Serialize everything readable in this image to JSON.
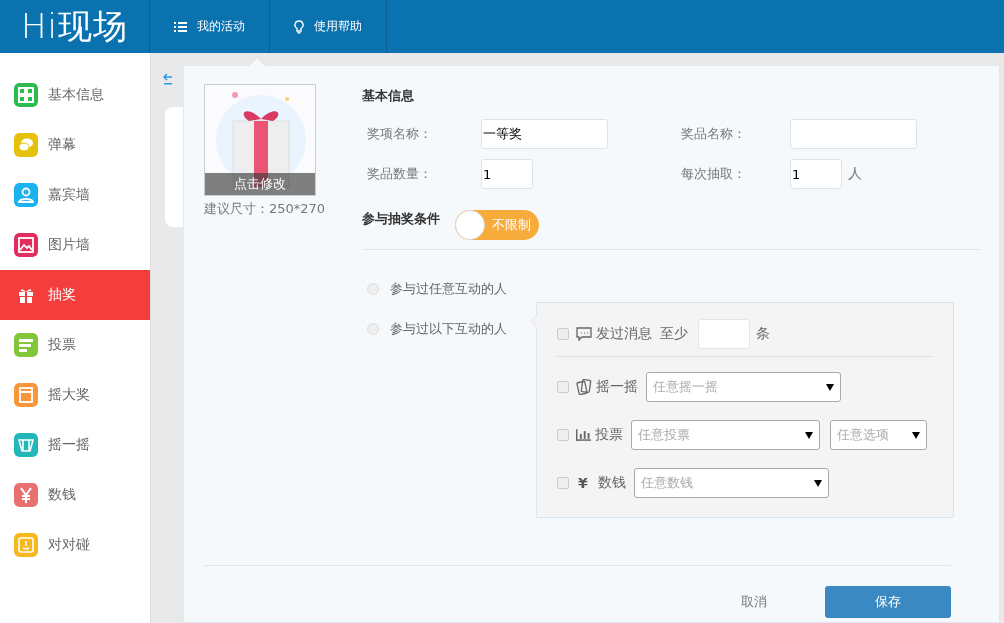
{
  "header": {
    "logo": "Hi现场",
    "nav": [
      {
        "label": "我的活动"
      },
      {
        "label": "使用帮助"
      }
    ]
  },
  "sidebar": {
    "items": [
      {
        "label": "基本信息",
        "color": "#2dbb4f",
        "selected": false
      },
      {
        "label": "弹幕",
        "color": "#e5c10c",
        "selected": false
      },
      {
        "label": "嘉宾墙",
        "color": "#1ab3f0",
        "selected": false
      },
      {
        "label": "图片墙",
        "color": "#e02e5f",
        "selected": false
      },
      {
        "label": "抽奖",
        "color": "#f43d3d",
        "selected": true
      },
      {
        "label": "投票",
        "color": "#82c63a",
        "selected": false
      },
      {
        "label": "摇大奖",
        "color": "#f7963a",
        "selected": false
      },
      {
        "label": "摇一摇",
        "color": "#22b8b9",
        "selected": false
      },
      {
        "label": "数钱",
        "color": "#e87070",
        "selected": false
      },
      {
        "label": "对对碰",
        "color": "#f5b81e",
        "selected": false
      }
    ]
  },
  "prize_image": {
    "overlay": "点击修改",
    "hint": "建议尺寸：250*270"
  },
  "basic_info": {
    "title": "基本信息",
    "fields": [
      {
        "label": "奖项名称：",
        "value": "一等奖",
        "kind": "wide"
      },
      {
        "label": "奖品名称：",
        "kind": "wide"
      },
      {
        "label": "奖品数量：",
        "value": "1",
        "kind": "narrow"
      },
      {
        "label": "每次抽取：",
        "value": "1",
        "kind": "narrow",
        "unit": "人"
      }
    ]
  },
  "condition": {
    "label": "参与抽奖条件",
    "toggle": {
      "on": false,
      "text": "不限制"
    },
    "options": [
      {
        "label": "参与过任意互动的人",
        "selected": false
      },
      {
        "label": "参与过以下互动的人",
        "selected": false
      }
    ],
    "interactions": [
      {
        "kind": "count",
        "label": "发过消息",
        "checked": false,
        "prefix": "至少",
        "suffix": "条"
      },
      {
        "kind": "select",
        "label": "摇一摇",
        "checked": false,
        "selects": [
          {
            "placeholder": "任意摇一摇",
            "kind": "wide"
          }
        ]
      },
      {
        "kind": "select",
        "label": "投票",
        "checked": false,
        "selects": [
          {
            "placeholder": "任意投票",
            "kind": "medium"
          },
          {
            "placeholder": "任意选项",
            "kind": "short"
          }
        ]
      },
      {
        "kind": "select",
        "symbol": "¥",
        "label": "数钱",
        "checked": false,
        "selects": [
          {
            "placeholder": "任意数钱",
            "kind": "medium"
          }
        ]
      }
    ]
  },
  "buttons": [
    {
      "kind": "link",
      "label": "取消"
    },
    {
      "kind": "primary",
      "label": "保存"
    }
  ]
}
